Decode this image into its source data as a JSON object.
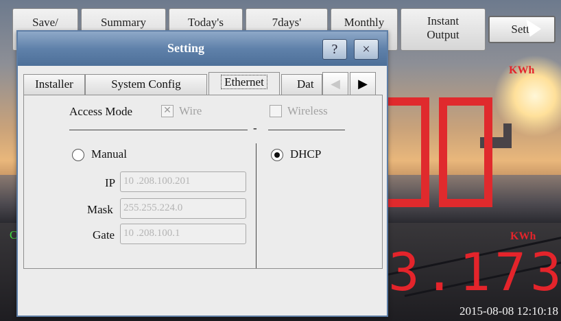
{
  "top_tabs": [
    "Save/",
    "Summary",
    "Today's",
    "7days'",
    "Monthly",
    "Instant Output",
    "Setti"
  ],
  "background": {
    "unit_top": "KWh",
    "unit_mid": "KWh",
    "big_value_top": "00",
    "big_value_bottom": "3.173",
    "green_label": "C",
    "datetime": "2015-08-08 12:10:18"
  },
  "dialog": {
    "title": "Setting",
    "help_glyph": "?",
    "close_glyph": "×",
    "tabs": [
      "Installer",
      "System Config",
      "Ethernet",
      "Dat"
    ],
    "prev_glyph": "◀",
    "next_glyph": "▶",
    "access_mode_label": "Access Mode",
    "wire_label": "Wire",
    "wireless_label": "Wireless",
    "separator": "-",
    "manual_label": "Manual",
    "dhcp_label": "DHCP",
    "ip_label": "IP",
    "ip_value": "10 .208.100.201",
    "mask_label": "Mask",
    "mask_value": "255.255.224.0",
    "gate_label": "Gate",
    "gate_value": "10 .208.100.1"
  },
  "colors": {
    "title_bar": "#5f81aa",
    "led_red": "#e4242b",
    "dialog_bg": "#ececec"
  },
  "icons": {
    "help": "question-icon",
    "close": "close-icon",
    "prev": "left-arrow-icon",
    "next": "right-arrow-icon",
    "cursor": "mouse-pointer-icon"
  }
}
